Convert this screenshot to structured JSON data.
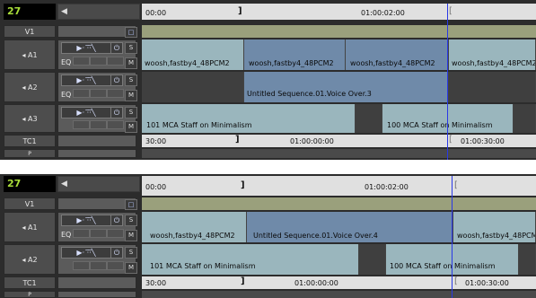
{
  "panels": [
    {
      "counter": "27",
      "ruler": {
        "left": "00:00",
        "right": "01:00:02:00"
      },
      "tracks": {
        "v1": "V1",
        "a1": "A1",
        "a2": "A2",
        "a3": "A3",
        "tc": "TC1"
      },
      "buttons": {
        "s": "S",
        "m": "M",
        "eq": "EQ",
        "power": "⏻",
        "monitor": "□",
        "pattern": "▶· ·̅·̅╲"
      },
      "clips": {
        "a1_1": "woosh,fastby4_48PCM2",
        "a1_2": "woosh,fastby4_48PCM2",
        "a1_3": "woosh,fastby4_48PCM2",
        "a1_4": "woosh,fastby4_48PCM2",
        "a2": "Untitled Sequence.01.Voice Over.3",
        "a3_1": "101 MCA Staff on Minimalism",
        "a3_2": "100 MCA Staff on Minimalism"
      },
      "tc": {
        "t1": "30:00",
        "t2": "01:00:00:00",
        "t3": "01:00:30:00"
      }
    },
    {
      "counter": "27",
      "ruler": {
        "left": "00:00",
        "right": "01:00:02:00"
      },
      "tracks": {
        "v1": "V1",
        "a1": "A1",
        "a2": "A2",
        "tc": "TC1"
      },
      "buttons": {
        "s": "S",
        "m": "M",
        "eq": "EQ",
        "power": "⏻",
        "monitor": "□",
        "pattern": "▶· ·̅·̅╲"
      },
      "clips": {
        "a1_1": "woosh,fastby4_48PCM2",
        "a1_2": "Untitled Sequence.01.Voice Over.4",
        "a1_3": "woosh,fastby4_48PCM2",
        "a2_1": "101 MCA Staff on Minimalism",
        "a2_2": "100 MCA Staff on Minimalism"
      },
      "tc": {
        "t1": "30:00",
        "t2": "01:00:00:00",
        "t3": "01:00:30:00"
      }
    }
  ]
}
